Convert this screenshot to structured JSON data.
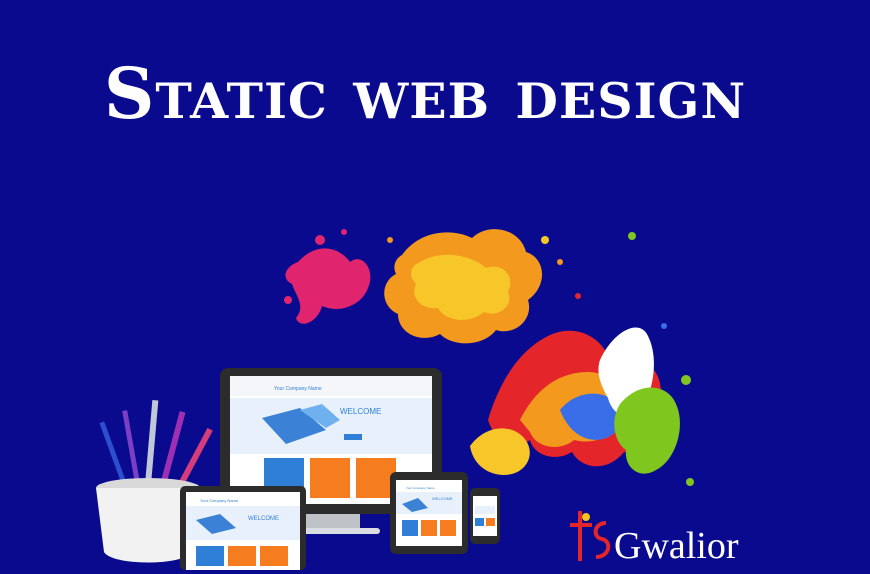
{
  "title": "Static web design",
  "screens": {
    "desktop": {
      "company": "Your Company Name",
      "hero": "WELCOME"
    },
    "laptop": {
      "company": "Your Company Name",
      "hero": "WELCOME"
    },
    "tablet": {
      "company": "Your Company Name",
      "hero": "WELCOME"
    }
  },
  "brand": {
    "mark": "ts",
    "word": "Gwalior"
  },
  "colors": {
    "background": "#0a0a8f",
    "tile_blue": "#2f7fd6",
    "tile_orange": "#f57c1f",
    "brand_red": "#e4252a",
    "brand_yellow": "#f6c21b"
  },
  "icons": [
    "paint-splash-icon",
    "pencil-cup-icon",
    "desktop-icon",
    "laptop-icon",
    "tablet-icon",
    "phone-icon"
  ]
}
